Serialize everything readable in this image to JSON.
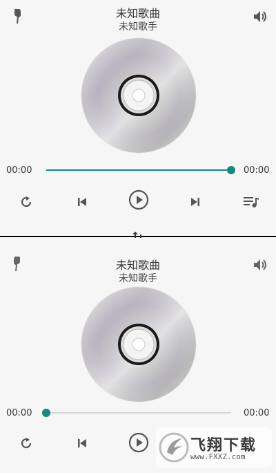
{
  "colors": {
    "accent": "#128c7e",
    "icon": "#555555",
    "track": "#d6d6d6"
  },
  "players": [
    {
      "title": "未知歌曲",
      "artist": "未知歌手",
      "current_time": "00:00",
      "total_time": "00:00",
      "progress": 1.0,
      "icons": {
        "headset": "earphone-icon",
        "volume": "volume-icon",
        "repeat": "repeat-icon",
        "prev": "skip-previous-icon",
        "play": "play-icon",
        "next": "skip-next-icon",
        "playlist": "playlist-icon"
      }
    },
    {
      "title": "未知歌曲",
      "artist": "未知歌手",
      "current_time": "00:00",
      "total_time": "00:00",
      "progress": 0.0,
      "icons": {
        "headset": "earphone-icon",
        "volume": "volume-icon",
        "repeat": "repeat-icon",
        "prev": "skip-previous-icon",
        "play": "play-icon"
      }
    }
  ],
  "watermark": {
    "text": "飞翔下载",
    "url": "www.FXXZ.com"
  }
}
